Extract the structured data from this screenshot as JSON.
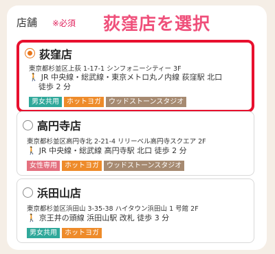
{
  "header": {
    "label": "店舗",
    "required": "※必須",
    "callout": "荻窪店を選択"
  },
  "colors": {
    "accent_pink": "#ef4f7a",
    "selected_border": "#e8102e",
    "radio_checked": "#e8751a",
    "tag_unisex": "#2fa89a",
    "tag_women": "#e4707f",
    "tag_hotyoga": "#ee8b2a",
    "tag_woodstone": "#a68a71"
  },
  "stores": [
    {
      "name": "荻窪店",
      "selected": true,
      "address": "東京都杉並区上荻 1-17-1 シンフォニーシティー 3F",
      "access_line1": "JR 中央線・総武線・東京メトロ丸ノ内線 荻窪駅 北口",
      "access_line2": "徒歩 2 分",
      "tags": [
        "男女共用",
        "ホットヨガ",
        "ウッドストーンスタジオ"
      ]
    },
    {
      "name": "高円寺店",
      "selected": false,
      "address": "東京都杉並区高円寺北 2-21-4 リリーベル高円寺スクエア 2F",
      "access_line1": "JR 中央線・総武線 高円寺駅 北口 徒歩 2 分",
      "tags": [
        "女性専用",
        "ホットヨガ",
        "ウッドストーンスタジオ"
      ]
    },
    {
      "name": "浜田山店",
      "selected": false,
      "address": "東京都杉並区浜田山 3-35-38 ハイタウン浜田山 1 号館 2F",
      "access_line1": "京王井の頭線 浜田山駅 改札 徒歩 3 分",
      "tags": [
        "男女共用",
        "ホットヨガ"
      ]
    }
  ]
}
